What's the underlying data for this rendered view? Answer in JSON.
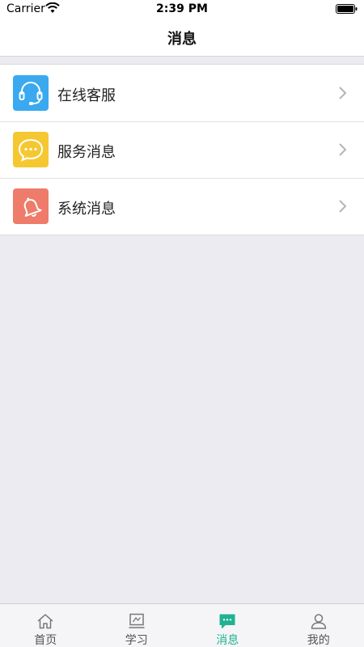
{
  "status_bar": {
    "carrier": "Carrier",
    "time": "2:39 PM"
  },
  "nav": {
    "title": "消息"
  },
  "list": {
    "items": [
      {
        "label": "在线客服",
        "icon": "headset-icon",
        "color": "#3aa9ef"
      },
      {
        "label": "服务消息",
        "icon": "chat-bubble-icon",
        "color": "#f5c832"
      },
      {
        "label": "系统消息",
        "icon": "bell-icon",
        "color": "#ef7b6a"
      }
    ]
  },
  "tabs": {
    "active_color": "#1fb391",
    "items": [
      {
        "label": "首页",
        "icon": "home-icon"
      },
      {
        "label": "学习",
        "icon": "study-icon"
      },
      {
        "label": "消息",
        "icon": "message-icon",
        "active": true
      },
      {
        "label": "我的",
        "icon": "profile-icon"
      }
    ]
  }
}
